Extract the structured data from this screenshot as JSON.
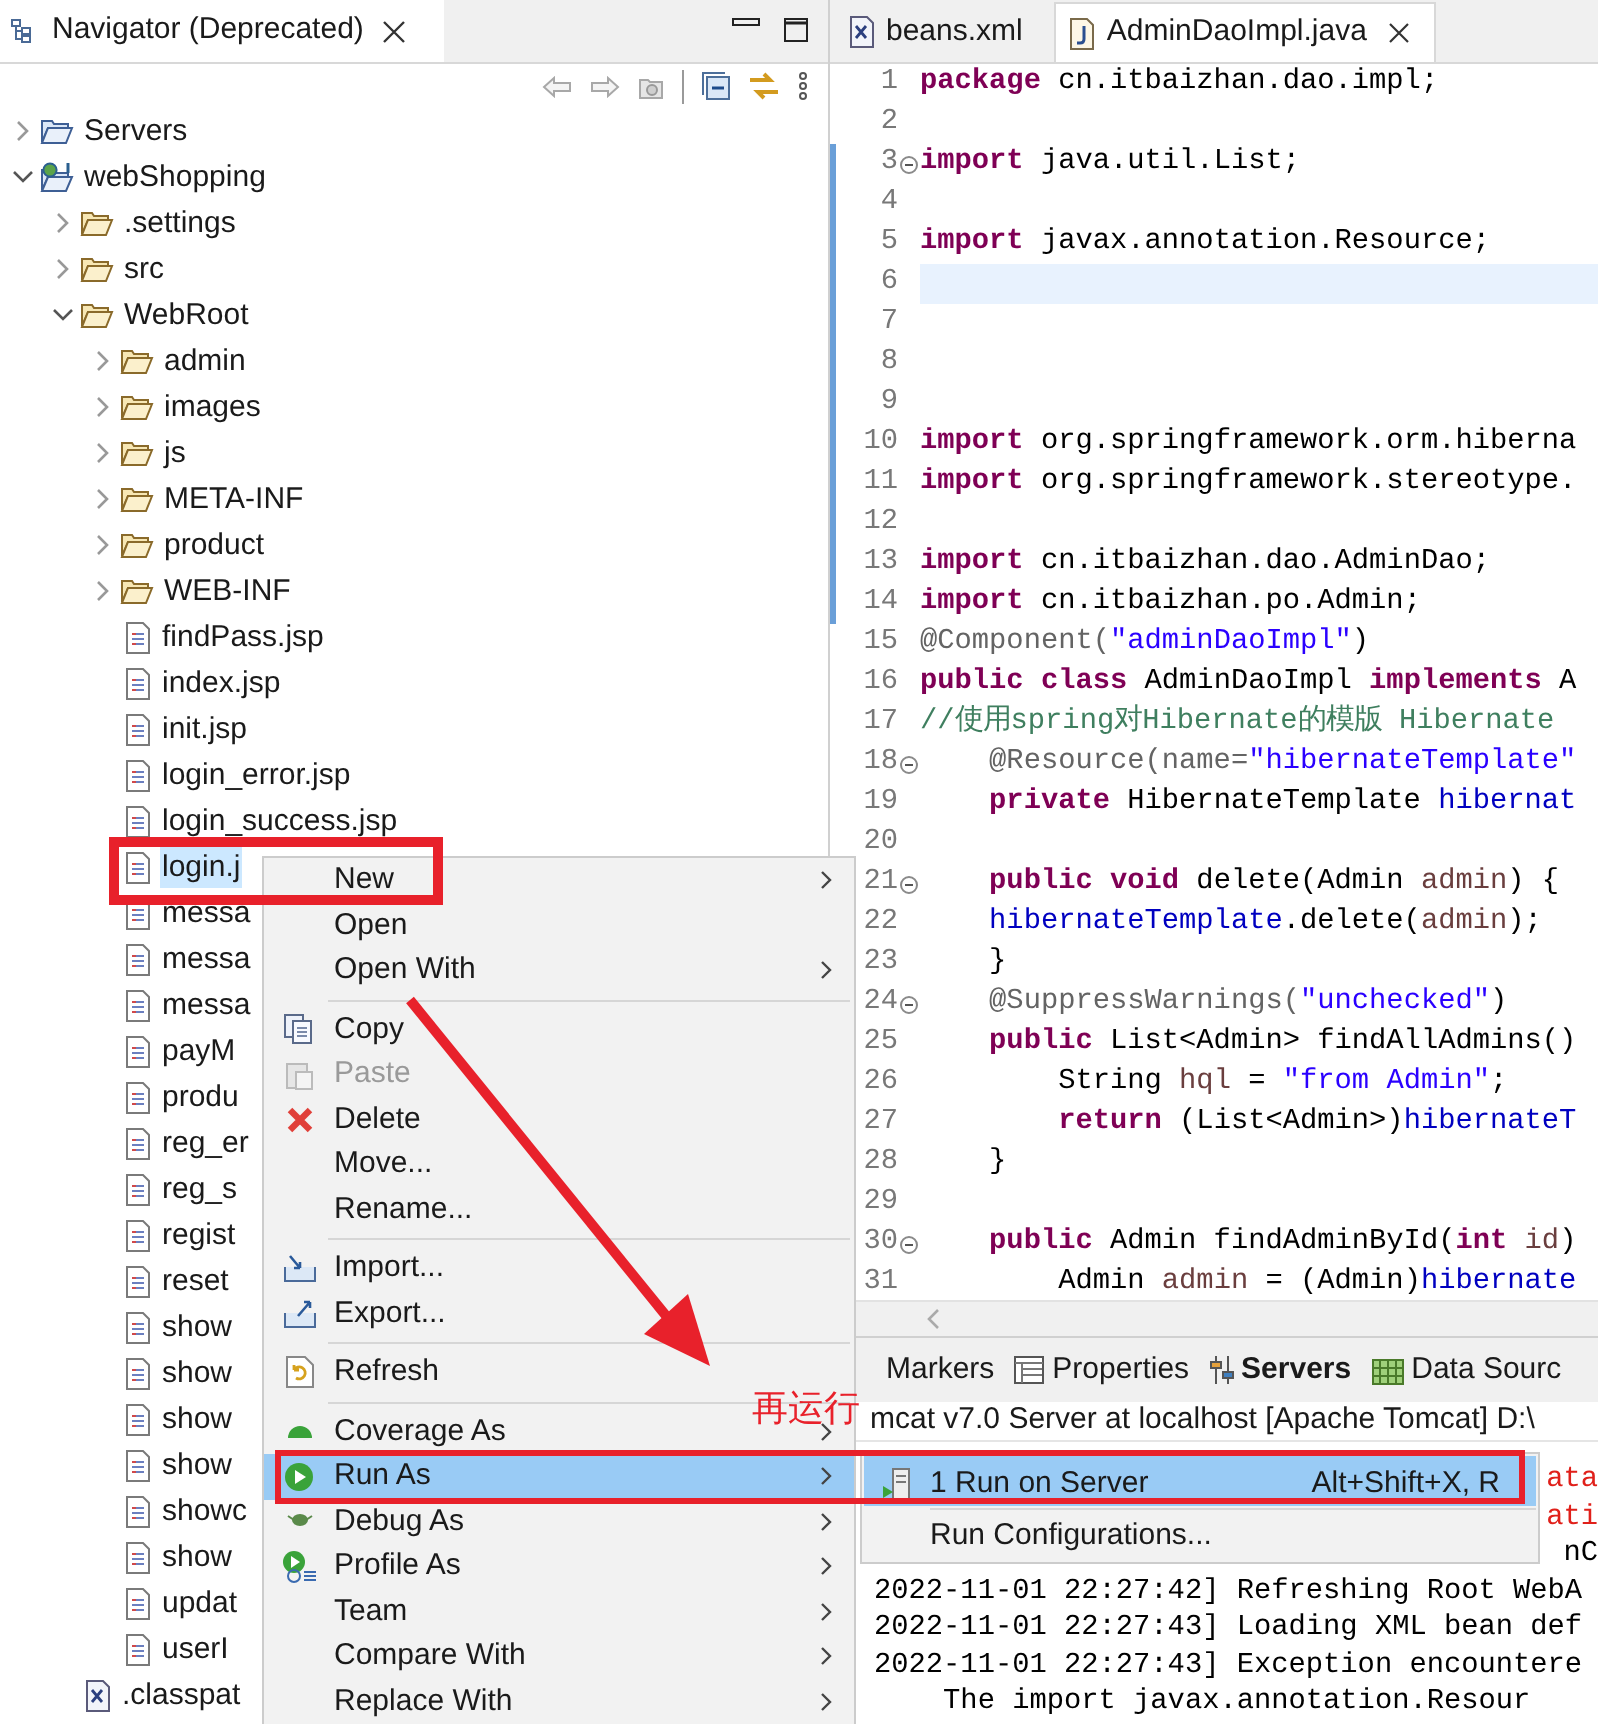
{
  "navigator": {
    "title": "Navigator (Deprecated)",
    "tree": [
      {
        "label": "Servers",
        "kind": "servers",
        "expanded": false,
        "selected": false
      },
      {
        "label": "webShopping",
        "kind": "project",
        "expanded": true,
        "selected": false,
        "children": [
          {
            "label": ".settings",
            "kind": "folder",
            "expanded": false,
            "selected": false
          },
          {
            "label": "src",
            "kind": "folder",
            "expanded": false,
            "selected": false
          },
          {
            "label": "WebRoot",
            "kind": "folder",
            "expanded": true,
            "selected": false,
            "children": [
              {
                "label": "admin",
                "kind": "folder",
                "expanded": false,
                "selected": false
              },
              {
                "label": "images",
                "kind": "folder",
                "expanded": false,
                "selected": false
              },
              {
                "label": "js",
                "kind": "folder",
                "expanded": false,
                "selected": false
              },
              {
                "label": "META-INF",
                "kind": "folder",
                "expanded": false,
                "selected": false
              },
              {
                "label": "product",
                "kind": "folder",
                "expanded": false,
                "selected": false
              },
              {
                "label": "WEB-INF",
                "kind": "folder",
                "expanded": false,
                "selected": false
              },
              {
                "label": "findPass.jsp",
                "kind": "file",
                "selected": false
              },
              {
                "label": "index.jsp",
                "kind": "file",
                "selected": false
              },
              {
                "label": "init.jsp",
                "kind": "file",
                "selected": false
              },
              {
                "label": "login_error.jsp",
                "kind": "file",
                "selected": false
              },
              {
                "label": "login_success.jsp",
                "kind": "file",
                "selected": false
              },
              {
                "label": "login.j",
                "kind": "file",
                "selected": true
              },
              {
                "label": "messa",
                "kind": "file",
                "selected": false
              },
              {
                "label": "messa",
                "kind": "file",
                "selected": false
              },
              {
                "label": "messa",
                "kind": "file",
                "selected": false
              },
              {
                "label": "payM",
                "kind": "file",
                "selected": false
              },
              {
                "label": "produ",
                "kind": "file",
                "selected": false
              },
              {
                "label": "reg_er",
                "kind": "file",
                "selected": false
              },
              {
                "label": "reg_s",
                "kind": "file",
                "selected": false
              },
              {
                "label": "regist",
                "kind": "file",
                "selected": false
              },
              {
                "label": "reset",
                "kind": "file",
                "selected": false
              },
              {
                "label": "show",
                "kind": "file",
                "selected": false
              },
              {
                "label": "show",
                "kind": "file",
                "selected": false
              },
              {
                "label": "show",
                "kind": "file",
                "selected": false
              },
              {
                "label": "show",
                "kind": "file",
                "selected": false
              },
              {
                "label": "showc",
                "kind": "file",
                "selected": false
              },
              {
                "label": "show",
                "kind": "file",
                "selected": false
              },
              {
                "label": "updat",
                "kind": "file",
                "selected": false
              },
              {
                "label": "userI",
                "kind": "file",
                "selected": false
              }
            ]
          },
          {
            "label": ".classpat",
            "kind": "xml",
            "selected": false
          }
        ]
      }
    ]
  },
  "editor": {
    "tabs": [
      {
        "label": "beans.xml",
        "kind": "xml",
        "selected": false
      },
      {
        "label": "AdminDaoImpl.java",
        "kind": "java",
        "selected": true
      }
    ],
    "lines": [
      {
        "n": "1",
        "code": [
          {
            "kind": "kw",
            "text": "package"
          },
          {
            "kind": "plain",
            "text": " cn.itbaizhan.dao.impl;"
          }
        ],
        "changed": false,
        "current": false,
        "fold": false
      },
      {
        "n": "2",
        "changed": false,
        "current": false,
        "fold": false
      },
      {
        "n": "3",
        "code": [
          {
            "kind": "kw",
            "text": "import"
          },
          {
            "kind": "plain",
            "text": " java.util.List;"
          }
        ],
        "changed": true,
        "current": false,
        "fold": true
      },
      {
        "n": "4",
        "changed": true,
        "current": false,
        "fold": false
      },
      {
        "n": "5",
        "code": [
          {
            "kind": "kw",
            "text": "import"
          },
          {
            "kind": "plain",
            "text": " javax.annotation.Resource;"
          }
        ],
        "changed": true,
        "current": false,
        "fold": false
      },
      {
        "n": "6",
        "changed": true,
        "current": true,
        "fold": false
      },
      {
        "n": "7",
        "changed": true,
        "current": false,
        "fold": false
      },
      {
        "n": "8",
        "changed": true,
        "current": false,
        "fold": false
      },
      {
        "n": "9",
        "changed": true,
        "current": false,
        "fold": false
      },
      {
        "n": "10",
        "code": [
          {
            "kind": "kw",
            "text": "import"
          },
          {
            "kind": "plain",
            "text": " org.springframework.orm.hiberna"
          }
        ],
        "changed": true,
        "current": false,
        "fold": false
      },
      {
        "n": "11",
        "code": [
          {
            "kind": "kw",
            "text": "import"
          },
          {
            "kind": "plain",
            "text": " org.springframework.stereotype."
          }
        ],
        "changed": true,
        "current": false,
        "fold": false
      },
      {
        "n": "12",
        "changed": true,
        "current": false,
        "fold": false
      },
      {
        "n": "13",
        "code": [
          {
            "kind": "kw",
            "text": "import"
          },
          {
            "kind": "plain",
            "text": " cn.itbaizhan.dao.AdminDao;"
          }
        ],
        "changed": true,
        "current": false,
        "fold": false
      },
      {
        "n": "14",
        "code": [
          {
            "kind": "kw",
            "text": "import"
          },
          {
            "kind": "plain",
            "text": " cn.itbaizhan.po.Admin;"
          }
        ],
        "changed": true,
        "current": false,
        "fold": false
      },
      {
        "n": "15",
        "code": [
          {
            "kind": "annotation",
            "text": "@Component("
          },
          {
            "kind": "string",
            "text": "\"adminDaoImpl\""
          },
          {
            "kind": "plain",
            "text": ")"
          }
        ],
        "changed": false,
        "current": false,
        "fold": false
      },
      {
        "n": "16",
        "code": [
          {
            "kind": "kw",
            "text": "public class"
          },
          {
            "kind": "plain",
            "text": " AdminDaoImpl "
          },
          {
            "kind": "kw",
            "text": "implements"
          },
          {
            "kind": "plain",
            "text": " A"
          }
        ],
        "changed": false,
        "current": false,
        "fold": false
      },
      {
        "n": "17",
        "code": [
          {
            "kind": "comment",
            "text": "//使用spring对Hibernate的模版 Hibernate"
          }
        ],
        "changed": false,
        "current": false,
        "fold": false
      },
      {
        "n": "18",
        "code": [
          {
            "kind": "annotation",
            "text": "    @Resource(name="
          },
          {
            "kind": "string",
            "text": "\"hibernateTemplate\""
          }
        ],
        "changed": false,
        "current": false,
        "fold": true
      },
      {
        "n": "19",
        "code": [
          {
            "kind": "kw",
            "text": "    private"
          },
          {
            "kind": "plain",
            "text": " HibernateTemplate "
          },
          {
            "kind": "field",
            "text": "hibernat"
          }
        ],
        "changed": false,
        "current": false,
        "fold": false
      },
      {
        "n": "20",
        "changed": false,
        "current": false,
        "fold": false
      },
      {
        "n": "21",
        "code": [
          {
            "kind": "kw",
            "text": "    public void"
          },
          {
            "kind": "plain",
            "text": " delete(Admin "
          },
          {
            "kind": "param",
            "text": "admin"
          },
          {
            "kind": "plain",
            "text": ") {"
          }
        ],
        "changed": false,
        "current": false,
        "fold": true
      },
      {
        "n": "22",
        "code": [
          {
            "kind": "field",
            "text": "    hibernateTemplate"
          },
          {
            "kind": "plain",
            "text": ".delete("
          },
          {
            "kind": "param",
            "text": "admin"
          },
          {
            "kind": "plain",
            "text": ");"
          }
        ],
        "changed": false,
        "current": false,
        "fold": false
      },
      {
        "n": "23",
        "code": [
          {
            "kind": "plain",
            "text": "    }"
          }
        ],
        "changed": false,
        "current": false,
        "fold": false
      },
      {
        "n": "24",
        "code": [
          {
            "kind": "annotation",
            "text": "    @SuppressWarnings("
          },
          {
            "kind": "string",
            "text": "\"unchecked\""
          },
          {
            "kind": "plain",
            "text": ")"
          }
        ],
        "changed": false,
        "current": false,
        "fold": true
      },
      {
        "n": "25",
        "code": [
          {
            "kind": "kw",
            "text": "    public"
          },
          {
            "kind": "plain",
            "text": " List<Admin> findAllAdmins()"
          }
        ],
        "changed": false,
        "current": false,
        "fold": false
      },
      {
        "n": "26",
        "code": [
          {
            "kind": "plain",
            "text": "        String "
          },
          {
            "kind": "param",
            "text": "hql"
          },
          {
            "kind": "plain",
            "text": " = "
          },
          {
            "kind": "string",
            "text": "\"from Admin\""
          },
          {
            "kind": "plain",
            "text": ";"
          }
        ],
        "changed": false,
        "current": false,
        "fold": false
      },
      {
        "n": "27",
        "code": [
          {
            "kind": "kw",
            "text": "        return"
          },
          {
            "kind": "plain",
            "text": " (List<Admin>)"
          },
          {
            "kind": "field",
            "text": "hibernateT"
          }
        ],
        "changed": false,
        "current": false,
        "fold": false
      },
      {
        "n": "28",
        "code": [
          {
            "kind": "plain",
            "text": "    }"
          }
        ],
        "changed": false,
        "current": false,
        "fold": false
      },
      {
        "n": "29",
        "changed": false,
        "current": false,
        "fold": false
      },
      {
        "n": "30",
        "code": [
          {
            "kind": "kw",
            "text": "    public"
          },
          {
            "kind": "plain",
            "text": " Admin findAdminById("
          },
          {
            "kind": "kw",
            "text": "int"
          },
          {
            "kind": "param",
            "text": " id"
          },
          {
            "kind": "plain",
            "text": ")"
          }
        ],
        "changed": false,
        "current": false,
        "fold": true
      },
      {
        "n": "31",
        "code": [
          {
            "kind": "plain",
            "text": "        Admin "
          },
          {
            "kind": "param",
            "text": "admin"
          },
          {
            "kind": "plain",
            "text": " = (Admin)"
          },
          {
            "kind": "field",
            "text": "hibernate"
          }
        ],
        "changed": false,
        "current": false,
        "fold": false
      }
    ]
  },
  "bottom_panel": {
    "tabs": [
      {
        "label": "Markers",
        "selected": false
      },
      {
        "label": "Properties",
        "selected": false
      },
      {
        "label": "Servers",
        "selected": true
      },
      {
        "label": "Data Sourc",
        "selected": false
      }
    ],
    "console_title": "mcat v7.0 Server at localhost [Apache Tomcat] D:\\",
    "console": [
      {
        "text": "ata",
        "kind": "error",
        "covered": true
      },
      {
        "text": "ati",
        "kind": "error",
        "covered": true
      },
      {
        "text": "nC",
        "kind": "info",
        "covered": true
      },
      {
        "text": "2022-11-01 22:27:42] Refreshing Root WebA",
        "kind": "info",
        "covered": false
      },
      {
        "text": "2022-11-01 22:27:43] Loading XML bean def",
        "kind": "info",
        "covered": false
      },
      {
        "text": "2022-11-01 22:27:43] Exception encountere",
        "kind": "info",
        "covered": false
      },
      {
        "text": "    The import javax.annotation.Resour",
        "kind": "info",
        "covered": false
      }
    ]
  },
  "context_menu": {
    "items": [
      {
        "kind": "item",
        "label": "New",
        "submenu": true,
        "disabled": false,
        "selected": false
      },
      {
        "kind": "item",
        "label": "Open",
        "submenu": false,
        "disabled": false,
        "selected": false
      },
      {
        "kind": "item",
        "label": "Open With",
        "submenu": true,
        "disabled": false,
        "selected": false
      },
      {
        "kind": "separator"
      },
      {
        "kind": "item",
        "label": "Copy",
        "submenu": false,
        "disabled": false,
        "selected": false
      },
      {
        "kind": "item",
        "label": "Paste",
        "submenu": false,
        "disabled": true,
        "selected": false
      },
      {
        "kind": "item",
        "label": "Delete",
        "submenu": false,
        "disabled": false,
        "selected": false
      },
      {
        "kind": "item",
        "label": "Move...",
        "submenu": false,
        "disabled": false,
        "selected": false
      },
      {
        "kind": "item",
        "label": "Rename...",
        "submenu": false,
        "disabled": false,
        "selected": false
      },
      {
        "kind": "separator"
      },
      {
        "kind": "item",
        "label": "Import...",
        "submenu": false,
        "disabled": false,
        "selected": false
      },
      {
        "kind": "item",
        "label": "Export...",
        "submenu": false,
        "disabled": false,
        "selected": false
      },
      {
        "kind": "separator"
      },
      {
        "kind": "item",
        "label": "Refresh",
        "submenu": false,
        "disabled": false,
        "selected": false
      },
      {
        "kind": "separator"
      },
      {
        "kind": "item",
        "label": "Coverage As",
        "submenu": true,
        "disabled": false,
        "selected": false
      },
      {
        "kind": "item",
        "label": "Run As",
        "submenu": true,
        "disabled": false,
        "selected": true
      },
      {
        "kind": "item",
        "label": "Debug As",
        "submenu": true,
        "disabled": false,
        "selected": false
      },
      {
        "kind": "item",
        "label": "Profile As",
        "submenu": true,
        "disabled": false,
        "selected": false
      },
      {
        "kind": "item",
        "label": "Team",
        "submenu": true,
        "disabled": false,
        "selected": false
      },
      {
        "kind": "item",
        "label": "Compare With",
        "submenu": true,
        "disabled": false,
        "selected": false
      },
      {
        "kind": "item",
        "label": "Replace With",
        "submenu": true,
        "disabled": false,
        "selected": false
      }
    ]
  },
  "run_as_submenu": {
    "items": [
      {
        "label": "1 Run on Server",
        "shortcut": "Alt+Shift+X, R",
        "selected": true
      },
      {
        "label": "Run Configurations...",
        "selected": false
      }
    ]
  },
  "annotation": {
    "note": "再运行"
  }
}
